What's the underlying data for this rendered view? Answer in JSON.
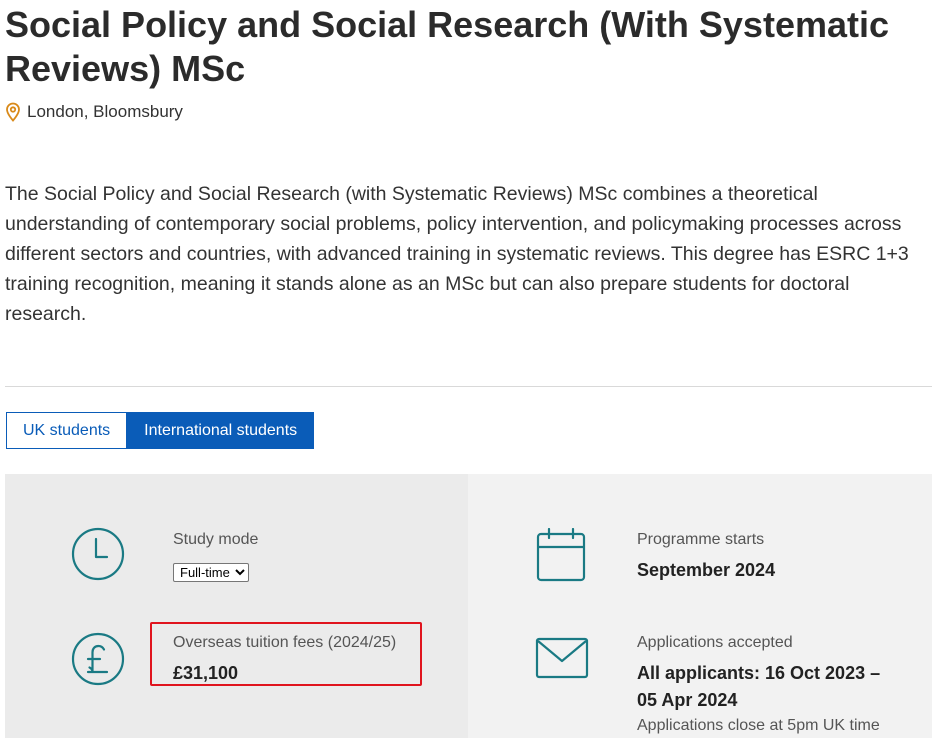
{
  "page": {
    "title": "Social Policy and Social Research (With Systematic Reviews) MSc",
    "location": "London, Bloomsbury",
    "intro": "The Social Policy and Social Research (with Systematic Reviews) MSc combines a theoretical understanding of contemporary social problems, policy intervention, and policymaking processes across different sectors and countries, with advanced training in systematic reviews. This degree has ESRC 1+3 training recognition, meaning it stands alone as an MSc but can also prepare students for doctoral research."
  },
  "tabs": [
    {
      "label": "UK students",
      "active": false
    },
    {
      "label": "International students",
      "active": true
    }
  ],
  "details": {
    "study_mode": {
      "label": "Study mode",
      "selected": "Full-time",
      "icon": "clock-icon"
    },
    "tuition": {
      "label": "Overseas tuition fees (2024/25)",
      "value": "£31,100",
      "icon": "pound-icon"
    },
    "start": {
      "label": "Programme starts",
      "value": "September 2024",
      "icon": "calendar-icon"
    },
    "applications": {
      "label": "Applications accepted",
      "value_line1": "All applicants: 16 Oct 2023 –",
      "value_line2": "05 Apr 2024",
      "note": "Applications close at 5pm UK time",
      "icon": "envelope-icon"
    }
  },
  "colors": {
    "accent": "#0a5cb8",
    "icon": "#1a7a84",
    "location_pin": "#d98a1a",
    "highlight": "#e0141e"
  }
}
